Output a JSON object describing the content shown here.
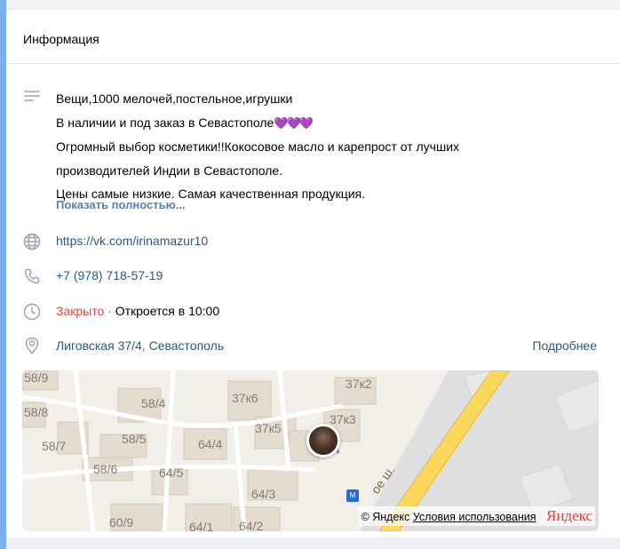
{
  "section_title": "Информация",
  "description": {
    "lines": [
      "Вещи,1000 мелочей,постельное,игрушки",
      "В наличии и под заказ в Севастополе",
      "Огромный выбор косметики!!Кокосовое масло и карепрост от лучших",
      "производителей Индии в Севастополе.",
      "Цены самые низкие. Самая качественная продукция."
    ],
    "hearts": "💜💜💜",
    "show_more": "Показать полностью..."
  },
  "website": "https://vk.com/irinamazur10",
  "phone": "+7 (978) 718-57-19",
  "hours": {
    "status": "Закрыто",
    "separator": "·",
    "next_open": "Откроется в 10:00"
  },
  "address": {
    "text": "Лиговская 37/4, Севастополь",
    "details_link": "Подробнее"
  },
  "map": {
    "labels": [
      "58/9",
      "58/8",
      "58/7",
      "58/4",
      "58/5",
      "58/6",
      "64/4",
      "64/5",
      "64/3",
      "64/2",
      "60/9",
      "64/1",
      "37к6",
      "37к5",
      "37к3",
      "37к2",
      "4",
      "ое ш."
    ],
    "copyright": "© Яндекс",
    "terms": "Условия использования",
    "logo": "Яндекс"
  },
  "colors": {
    "link": "#2a5885",
    "closed": "#e64646",
    "accent_bar": "#7eb0ee",
    "road": "#fbd75c"
  },
  "icons": {
    "description": "text-lines-icon",
    "website": "globe-icon",
    "phone": "phone-icon",
    "hours": "clock-icon",
    "address": "location-pin-icon"
  }
}
